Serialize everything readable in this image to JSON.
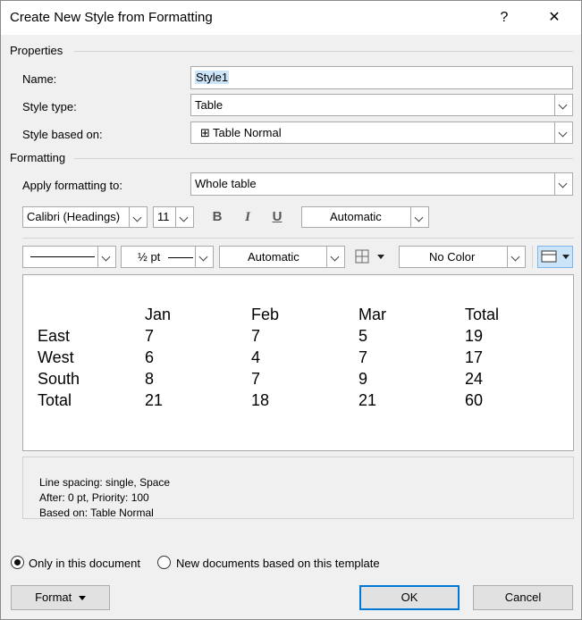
{
  "window": {
    "title": "Create New Style from Formatting",
    "help": "?",
    "close": "✕"
  },
  "properties": {
    "section": "Properties",
    "name_label": "Name:",
    "name_value": "Style1",
    "type_label": "Style type:",
    "type_value": "Table",
    "based_label": "Style based on:",
    "based_value": "Table Normal"
  },
  "formatting": {
    "section": "Formatting",
    "apply_label": "Apply formatting to:",
    "apply_value": "Whole table",
    "font": "Calibri (Headings)",
    "size": "11",
    "bold": "B",
    "italic": "I",
    "underline": "U",
    "font_color": "Automatic",
    "border_weight": "½ pt",
    "border_color": "Automatic",
    "shading": "No Color"
  },
  "preview": {
    "header": [
      "",
      "Jan",
      "Feb",
      "Mar",
      "Total"
    ],
    "rows": [
      [
        "East",
        "7",
        "7",
        "5",
        "19"
      ],
      [
        "West",
        "6",
        "4",
        "7",
        "17"
      ],
      [
        "South",
        "8",
        "7",
        "9",
        "24"
      ],
      [
        "Total",
        "21",
        "18",
        "21",
        "60"
      ]
    ]
  },
  "description": {
    "line1": "Line spacing:  single, Space",
    "line2": "After:  0 pt, Priority: 100",
    "line3": "Based on: Table Normal"
  },
  "options": {
    "only_doc": "Only in this document",
    "new_docs": "New documents based on this template"
  },
  "buttons": {
    "format": "Format",
    "ok": "OK",
    "cancel": "Cancel"
  },
  "colors": {
    "selection": "#cce4f7",
    "accent": "#0078d7"
  }
}
